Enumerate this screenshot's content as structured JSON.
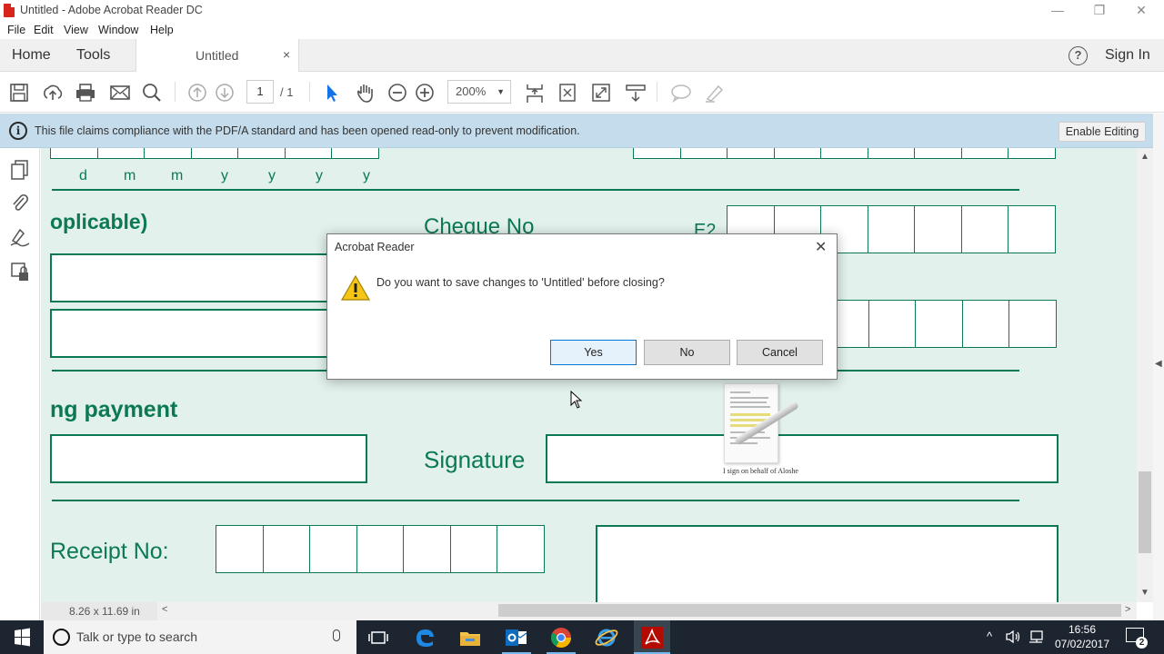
{
  "window": {
    "title": "Untitled - Adobe Acrobat Reader DC",
    "minimize_glyph": "—",
    "restore_glyph": "❐",
    "close_glyph": "✕"
  },
  "menu": [
    "File",
    "Edit",
    "View",
    "Window",
    "Help"
  ],
  "tabs": {
    "home": "Home",
    "tools": "Tools",
    "document": "Untitled",
    "close_glyph": "×",
    "help_glyph": "?",
    "sign_in": "Sign In"
  },
  "toolbar": {
    "page_current": "1",
    "page_total": "/ 1",
    "zoom": "200%",
    "zoom_caret": "▼",
    "icons": [
      "save-icon",
      "upload-icon",
      "print-icon",
      "email-icon",
      "search-icon",
      "page-up-icon",
      "page-down-icon",
      "select-arrow-icon",
      "hand-icon",
      "zoom-out-icon",
      "zoom-in-icon",
      "scroll-mode-icon",
      "fit-page-icon",
      "full-screen-icon",
      "read-mode-icon",
      "comment-icon",
      "highlight-icon"
    ]
  },
  "banner": {
    "info_glyph": "i",
    "message": "This file claims compliance with the PDF/A standard and has been opened read-only to prevent modification.",
    "enable_button": "Enable Editing"
  },
  "document": {
    "date_letters": [
      "d",
      "m",
      "m",
      "y",
      "y",
      "y",
      "y"
    ],
    "applicable_label": "oplicable)",
    "cheque_label": "Cheque No",
    "e2_label": "E2",
    "payment_label": "ng payment",
    "signature_label": "Signature",
    "receipt_label": "Receipt No:",
    "thumbnail_caption": "I sign on behalf of Aloshe",
    "page_size": "8.26 x 11.69 in"
  },
  "dialog": {
    "title": "Acrobat Reader",
    "close_glyph": "✕",
    "message": "Do you want to save changes to 'Untitled' before closing?",
    "yes": "Yes",
    "no": "No",
    "cancel": "Cancel"
  },
  "scroll": {
    "left_arrow": "<",
    "right_arrow": ">",
    "up_arrow": "▲",
    "down_arrow": "▼",
    "panel_left_arrow": "◀",
    "panel_right_arrow": "◀"
  },
  "taskbar": {
    "search_placeholder": "Talk or type to search",
    "time": "16:56",
    "date": "07/02/2017",
    "notification_count": "2",
    "tray_up_glyph": "^"
  },
  "colors": {
    "doc_green": "#0b7a52",
    "doc_bg": "#e2f1ec",
    "banner_bg": "#c4dcec",
    "taskbar_bg": "#1d2630"
  }
}
